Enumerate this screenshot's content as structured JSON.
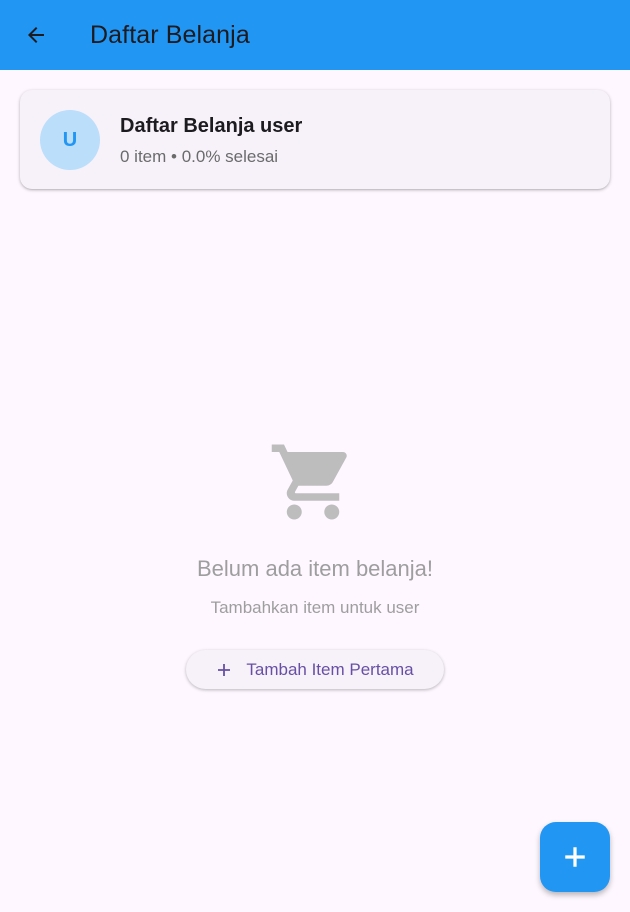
{
  "app_bar": {
    "title": "Daftar Belanja",
    "background_color": "#2196F3",
    "back_icon": "arrow-back-icon"
  },
  "summary": {
    "avatar_letter": "U",
    "title": "Daftar Belanja user",
    "subtitle": "0 item • 0.0% selesai"
  },
  "empty_state": {
    "icon": "shopping-cart-icon",
    "title": "Belum ada item belanja!",
    "subtitle": "Tambahkan item untuk user",
    "button_label": "Tambah Item Pertama",
    "button_icon": "plus-icon"
  },
  "fab": {
    "icon": "plus-icon",
    "color": "#2196F3"
  },
  "colors": {
    "accent": "#2196F3",
    "background": "#FEF7FF",
    "muted_text": "#9E9E9E",
    "button_text": "#6750A4"
  }
}
